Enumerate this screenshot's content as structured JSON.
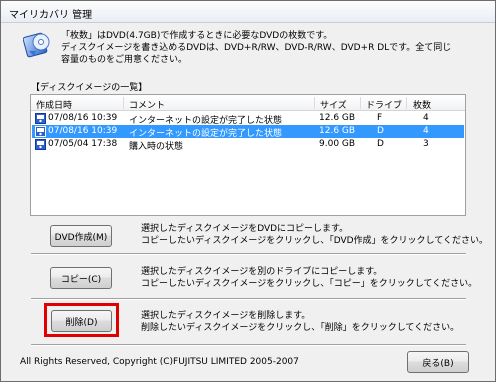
{
  "window": {
    "title": "マイリカバリ 管理"
  },
  "intro": {
    "lines": [
      "「枚数」はDVD(4.7GB)で作成するときに必要なDVDの枚数です。",
      "ディスクイメージを書き込めるDVDは、DVD+R/RW、DVD-R/RW、DVD+R DLです。全て同じ",
      "容量のものをご用意ください。"
    ]
  },
  "list": {
    "caption": "【ディスクイメージの一覧】",
    "columns": [
      "作成日時",
      "コメント",
      "サイズ",
      "ドライブ",
      "枚数"
    ],
    "rows": [
      {
        "date": "07/08/16 10:39",
        "comment": "インターネットの設定が完了した状態",
        "size": "12.6 GB",
        "drive": "F",
        "count": "4"
      },
      {
        "date": "07/08/16 10:39",
        "comment": "インターネットの設定が完了した状態",
        "size": "12.6 GB",
        "drive": "D",
        "count": "4"
      },
      {
        "date": "07/05/04 17:38",
        "comment": "購入時の状態",
        "size": "9.00 GB",
        "drive": "D",
        "count": "3"
      }
    ],
    "selected_index": 1
  },
  "actions": {
    "dvd": {
      "label": "DVD作成(M)",
      "desc1": "選択したディスクイメージをDVDにコピーします。",
      "desc2": "コピーしたいディスクイメージをクリックし、「DVD作成」をクリックしてください。"
    },
    "copy": {
      "label": "コピー(C)",
      "desc1": "選択したディスクイメージを別のドライブにコピーします。",
      "desc2": "コピーしたいディスクイメージをクリックし、「コピー」をクリックしてください。"
    },
    "delete": {
      "label": "削除(D)",
      "desc1": "選択したディスクイメージを削除します。",
      "desc2": "削除したいディスクイメージをクリックし、「削除」をクリックしてください。"
    }
  },
  "footer": {
    "copyright": "All Rights Reserved, Copyright (C)FUJITSU LIMITED 2005-2007",
    "back_label": "戻る(B)"
  },
  "colors": {
    "selection": "#3399ff",
    "highlight": "#e00000"
  },
  "icons": {
    "app": "recovery-disc-icon",
    "row": "disk-image-icon"
  }
}
